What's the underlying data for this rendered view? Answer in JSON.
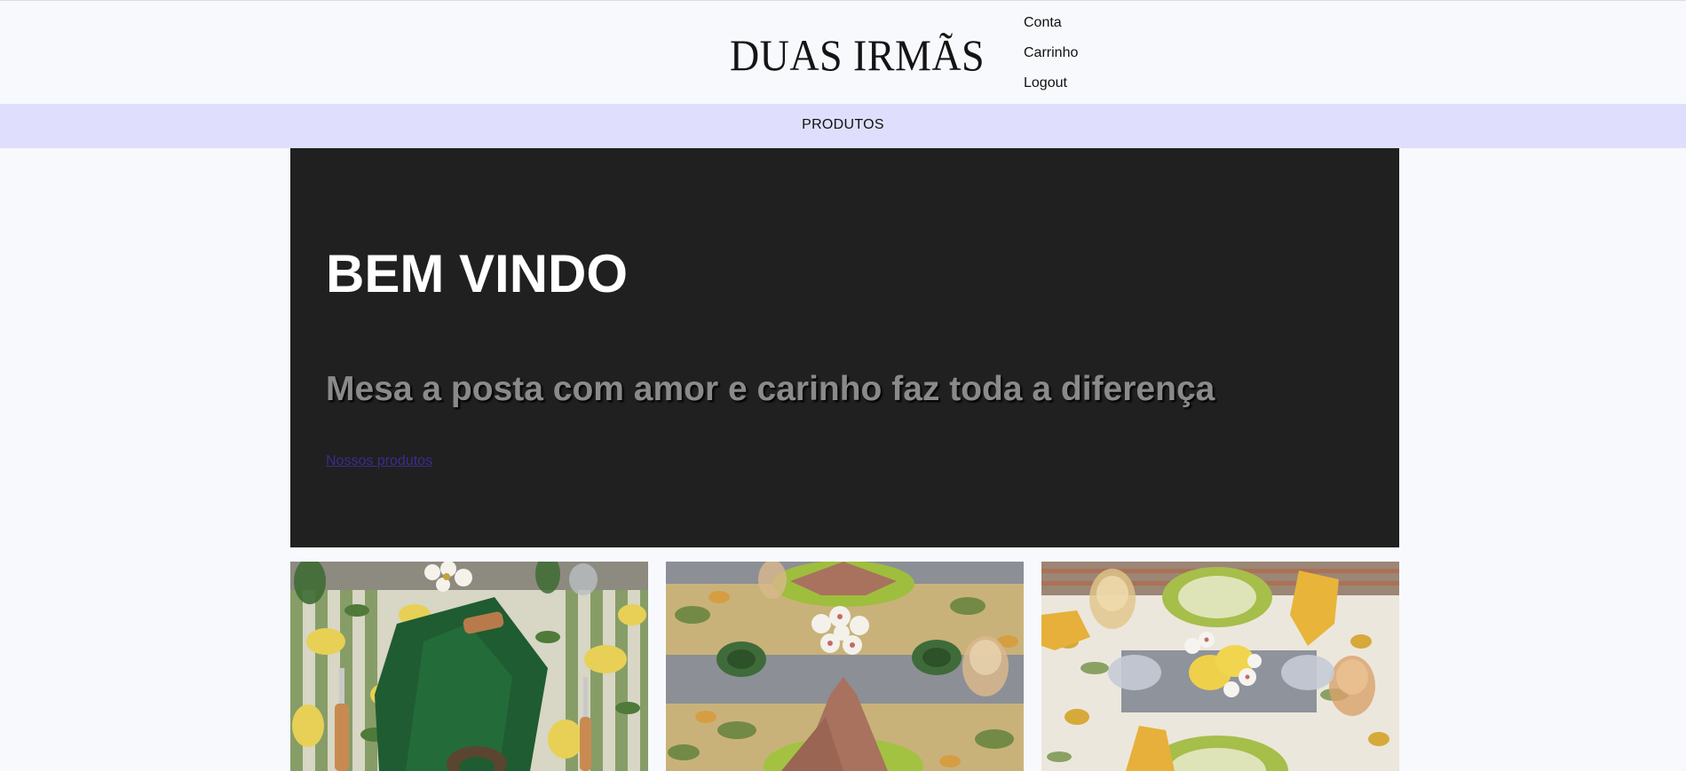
{
  "brand": {
    "name": "DUAS IRMÃS"
  },
  "account_menu": {
    "items": [
      {
        "label": "Conta"
      },
      {
        "label": "Carrinho"
      },
      {
        "label": "Logout"
      }
    ]
  },
  "nav": {
    "products_label": "PRODUTOS"
  },
  "hero": {
    "title": "BEM VINDO",
    "subtitle": "Mesa a posta com amor e carinho faz toda a diferença",
    "link_label": "Nossos produtos"
  },
  "colors": {
    "page_background": "#f8f9fd",
    "navbar_background": "#dfdffd",
    "hero_background": "#202020",
    "hero_title": "#ffffff",
    "hero_subtitle": "#8a8a8a",
    "link": "#3b2d8c"
  },
  "gallery": {
    "images": [
      {
        "name": "table-setting-green-napkin-photo"
      },
      {
        "name": "table-setting-pink-napkins-photo"
      },
      {
        "name": "table-setting-yellow-napkins-photo"
      }
    ]
  }
}
